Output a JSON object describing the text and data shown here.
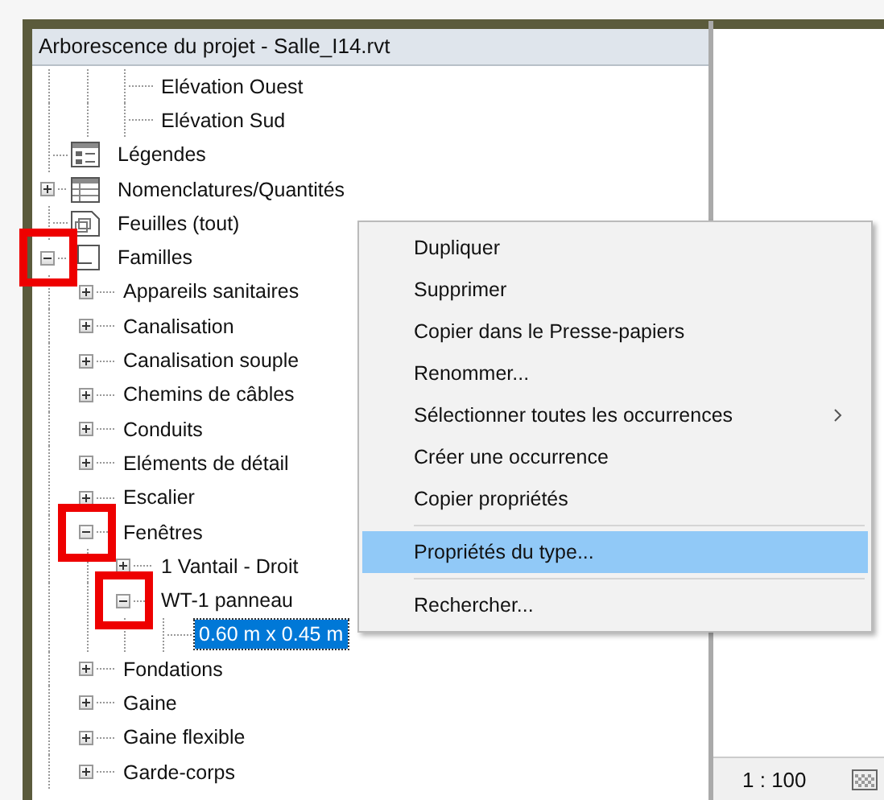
{
  "panel": {
    "title": "Arborescence du projet - Salle_I14.rvt"
  },
  "tree": {
    "clipped_branch": [
      {
        "label": "Elévation Ouest",
        "selected": false
      },
      {
        "label": "Elévation Sud",
        "selected": false
      }
    ],
    "items": [
      {
        "label": "Légendes",
        "kind": "legend",
        "selected": false,
        "highlighted": false
      },
      {
        "label": "Nomenclatures/Quantités",
        "kind": "schedule",
        "expanded": false,
        "selected": false,
        "highlighted": false
      },
      {
        "label": "Feuilles (tout)",
        "kind": "sheet",
        "selected": false,
        "highlighted": false
      },
      {
        "label": "Familles",
        "kind": "family",
        "expanded": true,
        "selected": false,
        "highlighted": true,
        "children": [
          {
            "label": "Appareils sanitaires",
            "expanded": false,
            "selected": false,
            "highlighted": false
          },
          {
            "label": "Canalisation",
            "expanded": false,
            "selected": false,
            "highlighted": false
          },
          {
            "label": "Canalisation souple",
            "expanded": false,
            "selected": false,
            "highlighted": false
          },
          {
            "label": "Chemins de câbles",
            "expanded": false,
            "selected": false,
            "highlighted": false
          },
          {
            "label": "Conduits",
            "expanded": false,
            "selected": false,
            "highlighted": false
          },
          {
            "label": "Eléments de détail",
            "expanded": false,
            "selected": false,
            "highlighted": false
          },
          {
            "label": "Escalier",
            "expanded": false,
            "selected": false,
            "highlighted": false
          },
          {
            "label": "Fenêtres",
            "expanded": true,
            "selected": false,
            "highlighted": true,
            "children": [
              {
                "label": "1 Vantail - Droit",
                "expanded": false,
                "selected": false,
                "highlighted": false
              },
              {
                "label": "WT-1 panneau",
                "expanded": true,
                "selected": false,
                "highlighted": true,
                "children": [
                  {
                    "label": "0.60 m x 0.45 m",
                    "selected": true,
                    "highlighted": false
                  }
                ]
              }
            ]
          },
          {
            "label": "Fondations",
            "expanded": false,
            "selected": false,
            "highlighted": false
          },
          {
            "label": "Gaine",
            "expanded": false,
            "selected": false,
            "highlighted": false
          },
          {
            "label": "Gaine flexible",
            "expanded": false,
            "selected": false,
            "highlighted": false
          },
          {
            "label": "Garde-corps",
            "expanded": false,
            "selected": false,
            "highlighted": false
          }
        ]
      }
    ]
  },
  "context_menu": {
    "items": [
      {
        "label": "Dupliquer",
        "selected": false,
        "separator_before": false,
        "submenu": false
      },
      {
        "label": "Supprimer",
        "selected": false,
        "separator_before": false,
        "submenu": false
      },
      {
        "label": "Copier dans le Presse-papiers",
        "selected": false,
        "separator_before": false,
        "submenu": false
      },
      {
        "label": "Renommer...",
        "selected": false,
        "separator_before": false,
        "submenu": false
      },
      {
        "label": "Sélectionner toutes les occurrences",
        "selected": false,
        "separator_before": false,
        "submenu": true
      },
      {
        "label": "Créer une occurrence",
        "selected": false,
        "separator_before": false,
        "submenu": false
      },
      {
        "label": "Copier propriétés",
        "selected": false,
        "separator_before": false,
        "submenu": false
      },
      {
        "label": "Propriétés du type...",
        "selected": true,
        "separator_before": true,
        "submenu": false
      },
      {
        "label": "Rechercher...",
        "selected": false,
        "separator_before": true,
        "submenu": false
      }
    ]
  },
  "status_bar": {
    "scale": "1 : 100"
  }
}
